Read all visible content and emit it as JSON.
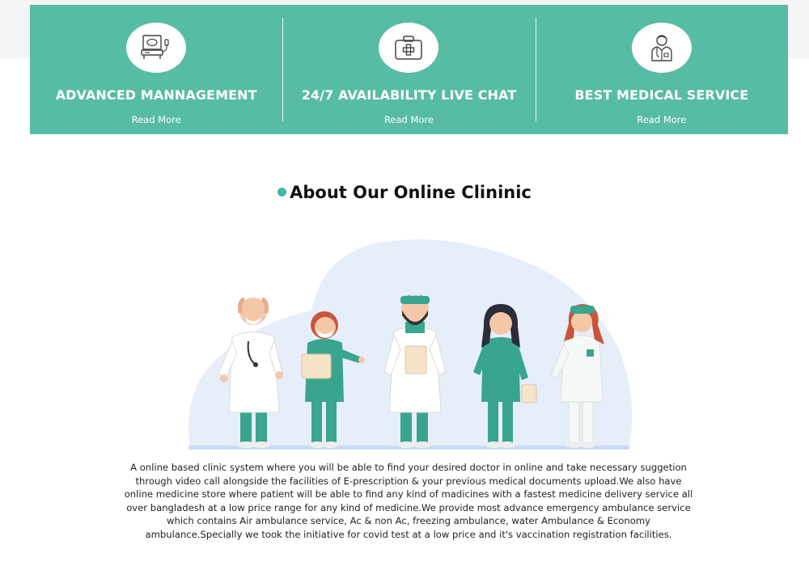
{
  "features": [
    {
      "icon": "ultrasound-machine-icon",
      "title": "ADVANCED MANNAGEMENT",
      "link": "Read More"
    },
    {
      "icon": "first-aid-kit-icon",
      "title": "24/7 AVAILABILITY LIVE CHAT",
      "link": "Read More"
    },
    {
      "icon": "doctor-icon",
      "title": "BEST MEDICAL SERVICE",
      "link": "Read More"
    }
  ],
  "about": {
    "title": "About Our Online Clininic",
    "text": "A online based clinic system where you will be able to find your desired doctor in online and take necessary suggetion through video call alongside the facilities of E-prescription & your previous medical documents upload.We also have online medicine store where patient will be able to find any kind of madicines with a fastest medicine delivery service all over bangladesh at a low price range for any kind of medicine.We provide most advance emergency ambulance service which contains Air ambulance service, Ac & non Ac, freezing ambulance, water Ambulance & Economy ambulance.Specially we took the initiative for covid test at a low price and it's vaccination registration facilities."
  },
  "colors": {
    "accent": "#57bca4",
    "dot": "#44b9aa",
    "background": "#ffffff",
    "strip": "#f3f4f5"
  }
}
